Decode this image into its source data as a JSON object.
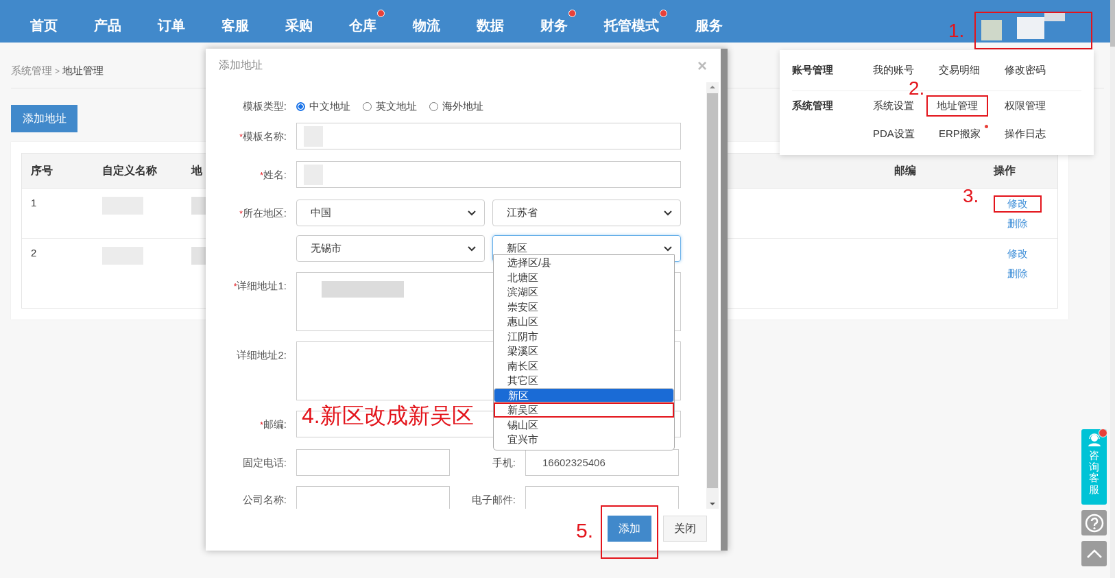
{
  "nav": [
    {
      "label": "首页"
    },
    {
      "label": "产品"
    },
    {
      "label": "订单"
    },
    {
      "label": "客服"
    },
    {
      "label": "采购"
    },
    {
      "label": "仓库",
      "dot": true
    },
    {
      "label": "物流"
    },
    {
      "label": "数据"
    },
    {
      "label": "财务",
      "dot": true
    },
    {
      "label": "托管模式",
      "dot": true
    },
    {
      "label": "服务"
    }
  ],
  "user": {
    "highlighted": true,
    "annotation": "1."
  },
  "breadcrumb": {
    "items": [
      "系统管理",
      "地址管理"
    ],
    "separator": ">"
  },
  "add_button": "添加地址",
  "table": {
    "columns": [
      "序号",
      "自定义名称",
      "地",
      "邮编",
      "操作"
    ],
    "rows": [
      {
        "index": "1",
        "actions": [
          {
            "label": "修改",
            "highlighted": true,
            "annotation": "3."
          },
          {
            "label": "删除",
            "highlighted": false
          }
        ]
      },
      {
        "index": "2",
        "actions": [
          {
            "label": "修改",
            "highlighted": false
          },
          {
            "label": "删除",
            "highlighted": false
          }
        ]
      }
    ]
  },
  "account_menu": {
    "groups": [
      {
        "title": "账号管理",
        "items": [
          {
            "label": "我的账号",
            "highlighted": false
          },
          {
            "label": "交易明细",
            "highlighted": false
          },
          {
            "label": "修改密码",
            "highlighted": false
          }
        ]
      },
      {
        "title": "系统管理",
        "items": [
          {
            "label": "系统设置",
            "highlighted": false
          },
          {
            "label": "地址管理",
            "highlighted": true,
            "annotation": "2."
          },
          {
            "label": "权限管理",
            "highlighted": false
          },
          {
            "label": "PDA设置",
            "highlighted": false
          },
          {
            "label": "ERP搬家",
            "highlighted": false,
            "dot": true
          },
          {
            "label": "操作日志",
            "highlighted": false
          }
        ]
      }
    ]
  },
  "dialog": {
    "title": "添加地址",
    "close": "×",
    "fields": [
      {
        "kind": "radio",
        "label": "模板类型:",
        "options": [
          {
            "label": "中文地址",
            "selected": true
          },
          {
            "label": "英文地址",
            "selected": false
          },
          {
            "label": "海外地址",
            "selected": false
          }
        ]
      },
      {
        "kind": "text",
        "mark": "*",
        "label": "模板名称:"
      },
      {
        "kind": "text",
        "mark": "*",
        "label": "姓名:"
      },
      {
        "kind": "region",
        "mark": "*",
        "label": "所在地区:",
        "selects": [
          {
            "value": "中国",
            "focused": false
          },
          {
            "value": "江苏省",
            "focused": false
          },
          {
            "value": "无锡市",
            "focused": false
          },
          {
            "value": "新区",
            "focused": true
          }
        ]
      },
      {
        "kind": "textarea",
        "mark": "*",
        "label": "详细地址1:"
      },
      {
        "kind": "textarea",
        "label": "详细地址2:"
      },
      {
        "kind": "text",
        "mark": "*",
        "label": "邮编:"
      },
      {
        "kind": "pair",
        "cells": [
          {
            "label": "固定电话:"
          },
          {
            "label": "手机:",
            "value": "16602325406"
          }
        ]
      },
      {
        "kind": "pair",
        "cells": [
          {
            "label": "公司名称:"
          },
          {
            "label": "电子邮件:"
          }
        ]
      }
    ],
    "dropdown": {
      "options": [
        {
          "label": "选择区/县",
          "selected": false,
          "highlighted": false
        },
        {
          "label": "北塘区",
          "selected": false,
          "highlighted": false
        },
        {
          "label": "滨湖区",
          "selected": false,
          "highlighted": false
        },
        {
          "label": "崇安区",
          "selected": false,
          "highlighted": false
        },
        {
          "label": "惠山区",
          "selected": false,
          "highlighted": false
        },
        {
          "label": "江阴市",
          "selected": false,
          "highlighted": false
        },
        {
          "label": "梁溪区",
          "selected": false,
          "highlighted": false
        },
        {
          "label": "南长区",
          "selected": false,
          "highlighted": false
        },
        {
          "label": "其它区",
          "selected": false,
          "highlighted": false
        },
        {
          "label": "新区",
          "selected": true,
          "highlighted": false
        },
        {
          "label": "新吴区",
          "selected": false,
          "highlighted": true,
          "annotation": "4.新区改成新吴区"
        },
        {
          "label": "锡山区",
          "selected": false,
          "highlighted": false
        },
        {
          "label": "宜兴市",
          "selected": false,
          "highlighted": false
        }
      ]
    },
    "buttons": [
      {
        "label": "添加",
        "kind": "primary",
        "highlighted": true,
        "annotation": "5."
      },
      {
        "label": "关闭",
        "kind": "default"
      }
    ]
  },
  "float_tools": {
    "consult": "咨询客服",
    "dot": true
  }
}
